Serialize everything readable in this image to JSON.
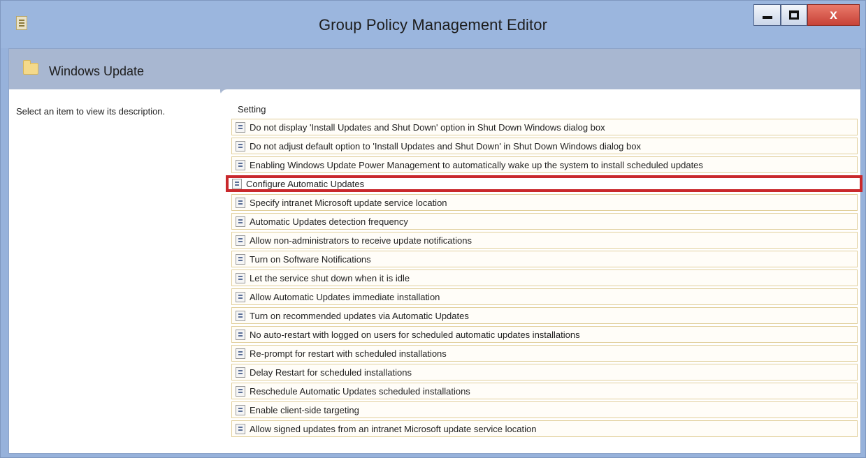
{
  "window": {
    "title": "Group Policy Management Editor",
    "controls": {
      "minimize": "-",
      "maximize": "□",
      "close": "x"
    }
  },
  "header": {
    "title": "Windows Update"
  },
  "left_pane": {
    "description": "Select an item to view its description."
  },
  "table": {
    "column_header": "Setting",
    "rows": [
      "Do not display 'Install Updates and Shut Down' option in Shut Down Windows dialog box",
      "Do not adjust default option to 'Install Updates and Shut Down' in Shut Down Windows dialog box",
      "Enabling Windows Update Power Management to automatically wake up the system to install scheduled updates",
      "Configure Automatic Updates",
      "Specify intranet Microsoft update service location",
      "Automatic Updates detection frequency",
      "Allow non-administrators to receive update notifications",
      "Turn on Software Notifications",
      "Let the service shut down when it is idle",
      "Allow Automatic Updates immediate installation",
      "Turn on recommended updates via Automatic Updates",
      "No auto-restart with logged on users for scheduled automatic updates installations",
      "Re-prompt for restart with scheduled installations",
      "Delay Restart for scheduled installations",
      "Reschedule Automatic Updates scheduled installations",
      "Enable client-side targeting",
      "Allow signed updates from an intranet Microsoft update service location"
    ],
    "highlighted_row": "Configure Automatic Updates"
  },
  "colors": {
    "titlebar": "#9bb6de",
    "header": "#a8b7d1",
    "row_border": "#e1cf9b",
    "highlight": "#c9282c",
    "close_button": "#c74237"
  },
  "icons": {
    "app": "policy-editor-icon",
    "folder": "folder-icon",
    "setting": "policy-setting-icon"
  }
}
